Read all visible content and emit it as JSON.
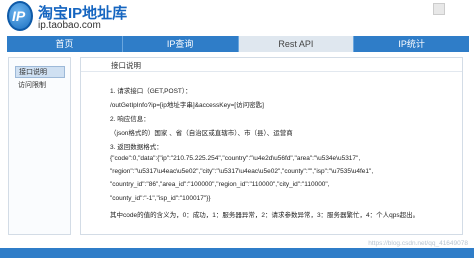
{
  "header": {
    "logo_glyph": "IP",
    "title": "淘宝IP地址库",
    "url": "ip.taobao.com"
  },
  "nav": {
    "items": [
      {
        "label": "首页"
      },
      {
        "label": "IP查询"
      },
      {
        "label": "Rest API",
        "active": true
      },
      {
        "label": "IP统计"
      }
    ]
  },
  "sidebar": {
    "items": [
      {
        "label": "接口说明",
        "active": true
      },
      {
        "label": "访问限制"
      }
    ]
  },
  "main": {
    "title": "接口说明",
    "lines": [
      "1. 请求接口（GET,POST）：",
      "/outGetIpInfo?ip=[ip地址字串]&accessKey=[访问密匙]",
      "2. 响应信息：",
      "（json格式的）国家 、省（自治区或直辖市）、市（县）、运营商",
      "3. 返回数据格式：",
      "{\"code\":0,\"data\":{\"ip\":\"210.75.225.254\",\"country\":\"\\u4e2d\\u56fd\",\"area\":\"\\u534e\\u5317\",",
      "\"region\":\"\\u5317\\u4eac\\u5e02\",\"city\":\"\\u5317\\u4eac\\u5e02\",\"county\":\"\",\"isp\":\"\\u7535\\u4fe1\",",
      "\"country_id\":\"86\",\"area_id\":\"100000\",\"region_id\":\"110000\",\"city_id\":\"110000\",",
      "\"county_id\":\"-1\",\"isp_id\":\"100017\"}}",
      "其中code的值的含义为，0：成功，1：服务器异常，2：请求参数异常，3：服务器繁忙，4：个人qps超出。"
    ]
  },
  "watermark": "https://blog.csdn.net/qq_41649078"
}
